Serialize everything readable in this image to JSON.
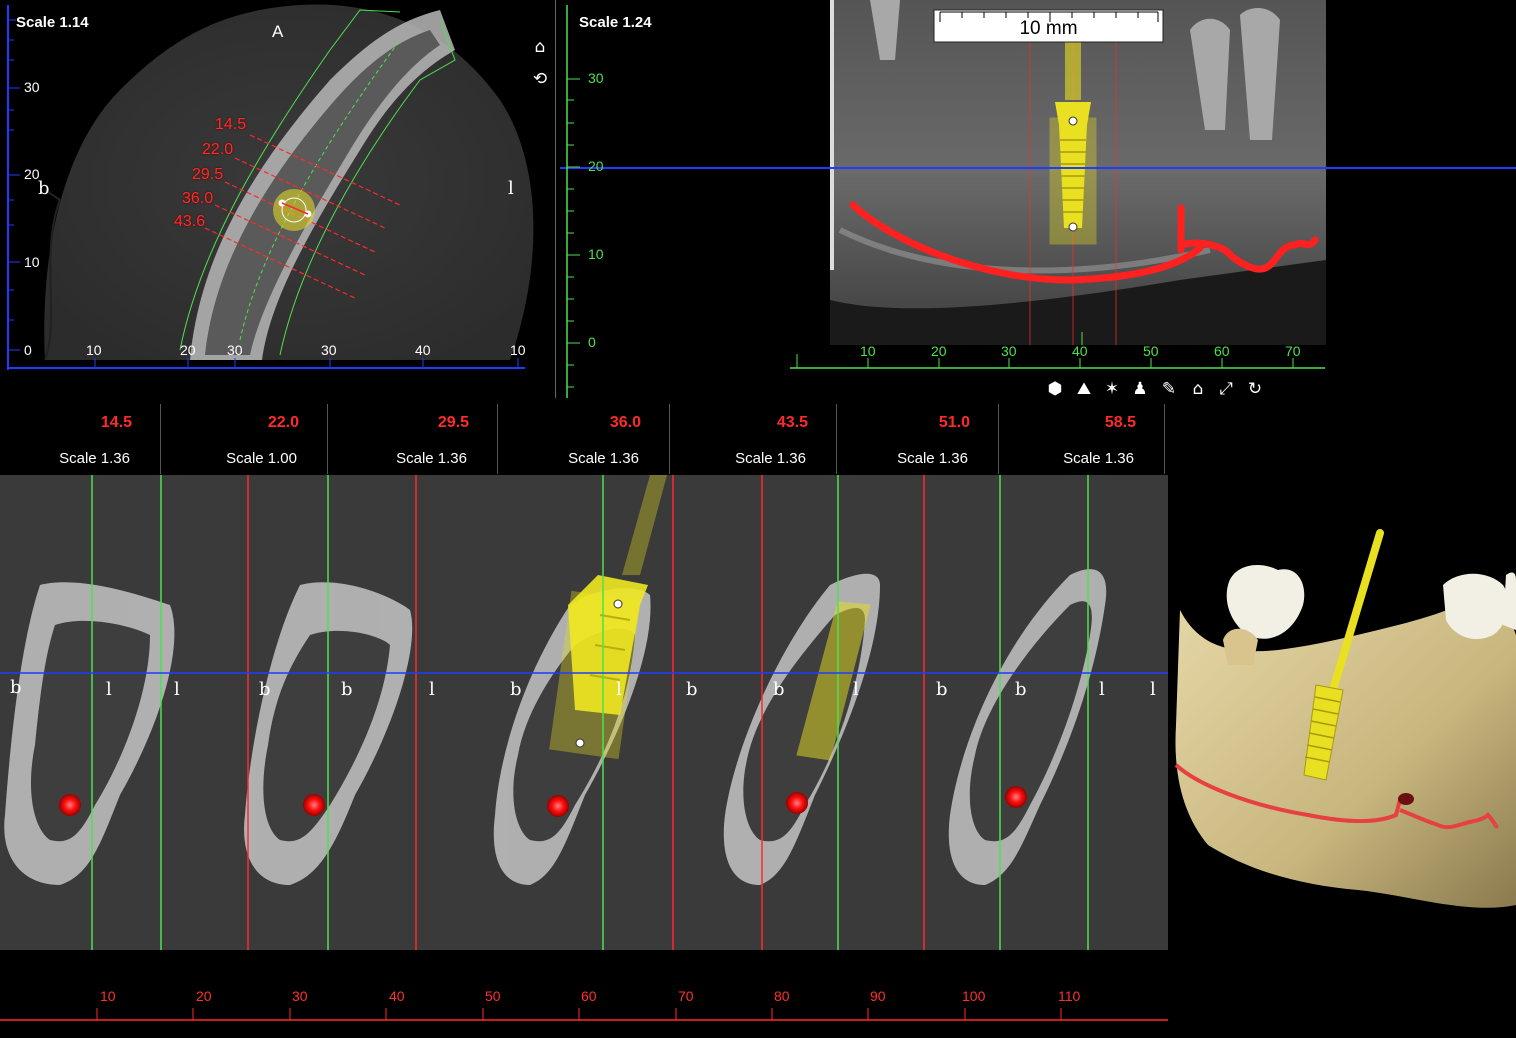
{
  "axial": {
    "scale": "Scale 1.14",
    "orientation_top": "A",
    "left_mark": "b",
    "right_mark": "l",
    "y_ticks": [
      "30",
      "20",
      "10",
      "0"
    ],
    "x_ticks": [
      "10",
      "20",
      "30",
      "30",
      "40",
      "10"
    ],
    "section_labels": [
      "14.5",
      "22.0",
      "29.5",
      "36.0",
      "43.6"
    ]
  },
  "side_icons": [
    "home-icon",
    "home-refresh-icon"
  ],
  "pano": {
    "scale": "Scale 1.24",
    "ruler": "10 mm",
    "y_ticks": [
      "30",
      "20",
      "10",
      "0"
    ],
    "x_ticks": [
      "10",
      "20",
      "30",
      "40",
      "50",
      "60",
      "70"
    ]
  },
  "toolbar_icons": [
    "cube-icon",
    "layers-icon",
    "person-icon",
    "figure-icon",
    "tools-icon",
    "home-icon",
    "expand-icon",
    "rotate-icon"
  ],
  "slices": [
    {
      "num": "14.5",
      "scale": "Scale 1.36"
    },
    {
      "num": "22.0",
      "scale": "Scale 1.00"
    },
    {
      "num": "29.5",
      "scale": "Scale 1.36"
    },
    {
      "num": "36.0",
      "scale": "Scale 1.36"
    },
    {
      "num": "43.5",
      "scale": "Scale 1.36"
    },
    {
      "num": "51.0",
      "scale": "Scale 1.36"
    },
    {
      "num": "58.5",
      "scale": "Scale 1.36"
    }
  ],
  "slice_marks": [
    "b",
    "l",
    "l",
    "b",
    "b",
    "l",
    "b",
    "l",
    "b",
    "b",
    "l",
    "b",
    "b",
    "l",
    "l"
  ],
  "bottom_ticks": [
    "10",
    "20",
    "30",
    "40",
    "50",
    "60",
    "70",
    "80",
    "90",
    "100",
    "110"
  ],
  "colors": {
    "red": "#ff2a2a",
    "green": "#4fe04f",
    "blue": "#1f3cff",
    "implant": "#e8e020",
    "bone": "#d9c99a"
  }
}
